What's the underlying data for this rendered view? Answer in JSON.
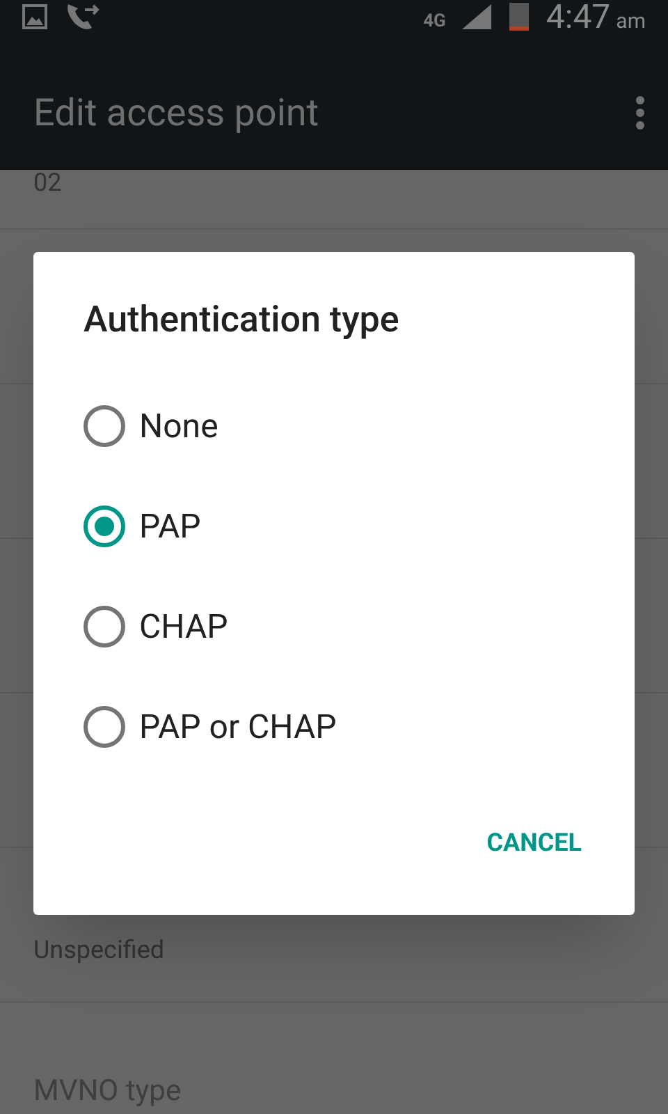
{
  "status_bar": {
    "network": "4G",
    "time": "4:47",
    "time_suffix": "am"
  },
  "app_bar": {
    "title": "Edit access point"
  },
  "settings": [
    {
      "value": "02"
    },
    {
      "value": "Unspecified"
    },
    {
      "title": "MVNO type"
    }
  ],
  "dialog": {
    "title": "Authentication type",
    "options": [
      {
        "label": "None",
        "selected": false
      },
      {
        "label": "PAP",
        "selected": true
      },
      {
        "label": "CHAP",
        "selected": false
      },
      {
        "label": "PAP or CHAP",
        "selected": false
      }
    ],
    "buttons": [
      "CANCEL"
    ]
  }
}
